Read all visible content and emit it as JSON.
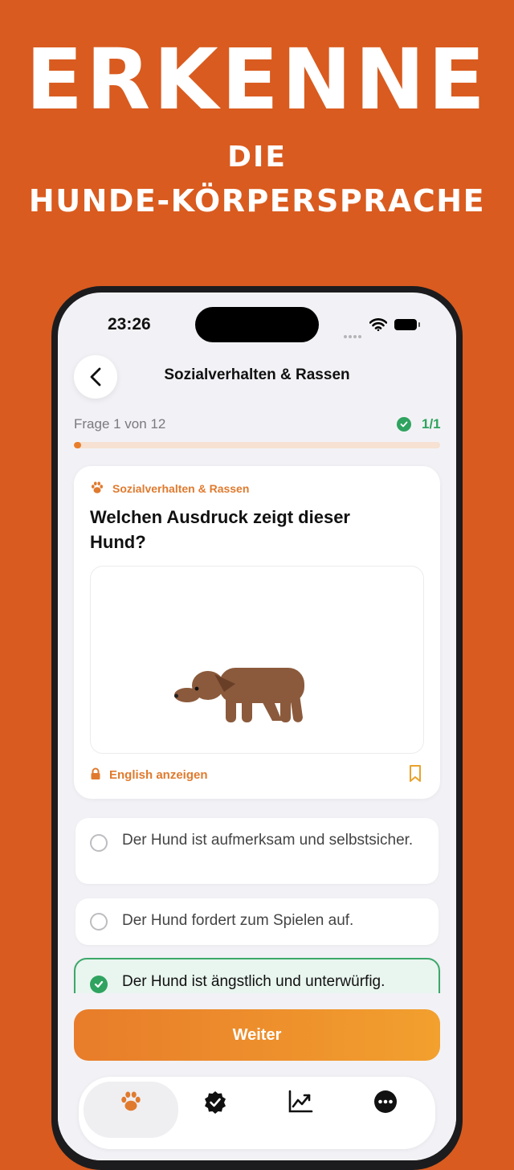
{
  "promo": {
    "line1": "ERKENNE",
    "line2": "DIE",
    "line3": "HUNDE-KÖRPERSPRACHE"
  },
  "status_bar": {
    "time": "23:26"
  },
  "nav": {
    "title": "Sozialverhalten & Rassen"
  },
  "progress": {
    "counter": "Frage 1 von 12",
    "score": "1/1",
    "fraction": 0.02
  },
  "question_card": {
    "category": "Sozialverhalten & Rassen",
    "question": "Welchen Ausdruck zeigt dieser Hund?",
    "english_toggle": "English anzeigen"
  },
  "answers": [
    {
      "text": "Der Hund ist aufmerksam und selbstsicher.",
      "selected": false
    },
    {
      "text": "Der Hund fordert zum Spielen auf.",
      "selected": false
    },
    {
      "text": "Der Hund ist ängstlich und unterwürfig.",
      "selected": true
    }
  ],
  "continue_button": {
    "label": "Weiter"
  },
  "tabbar": {
    "tabs": [
      "paw-icon",
      "verified-badge-icon",
      "chart-icon",
      "more-icon"
    ],
    "active": 0
  },
  "colors": {
    "background": "#D95B1F",
    "accent": "#E87E2C",
    "success": "#2FA35F",
    "dog": "#8B5A3C"
  }
}
